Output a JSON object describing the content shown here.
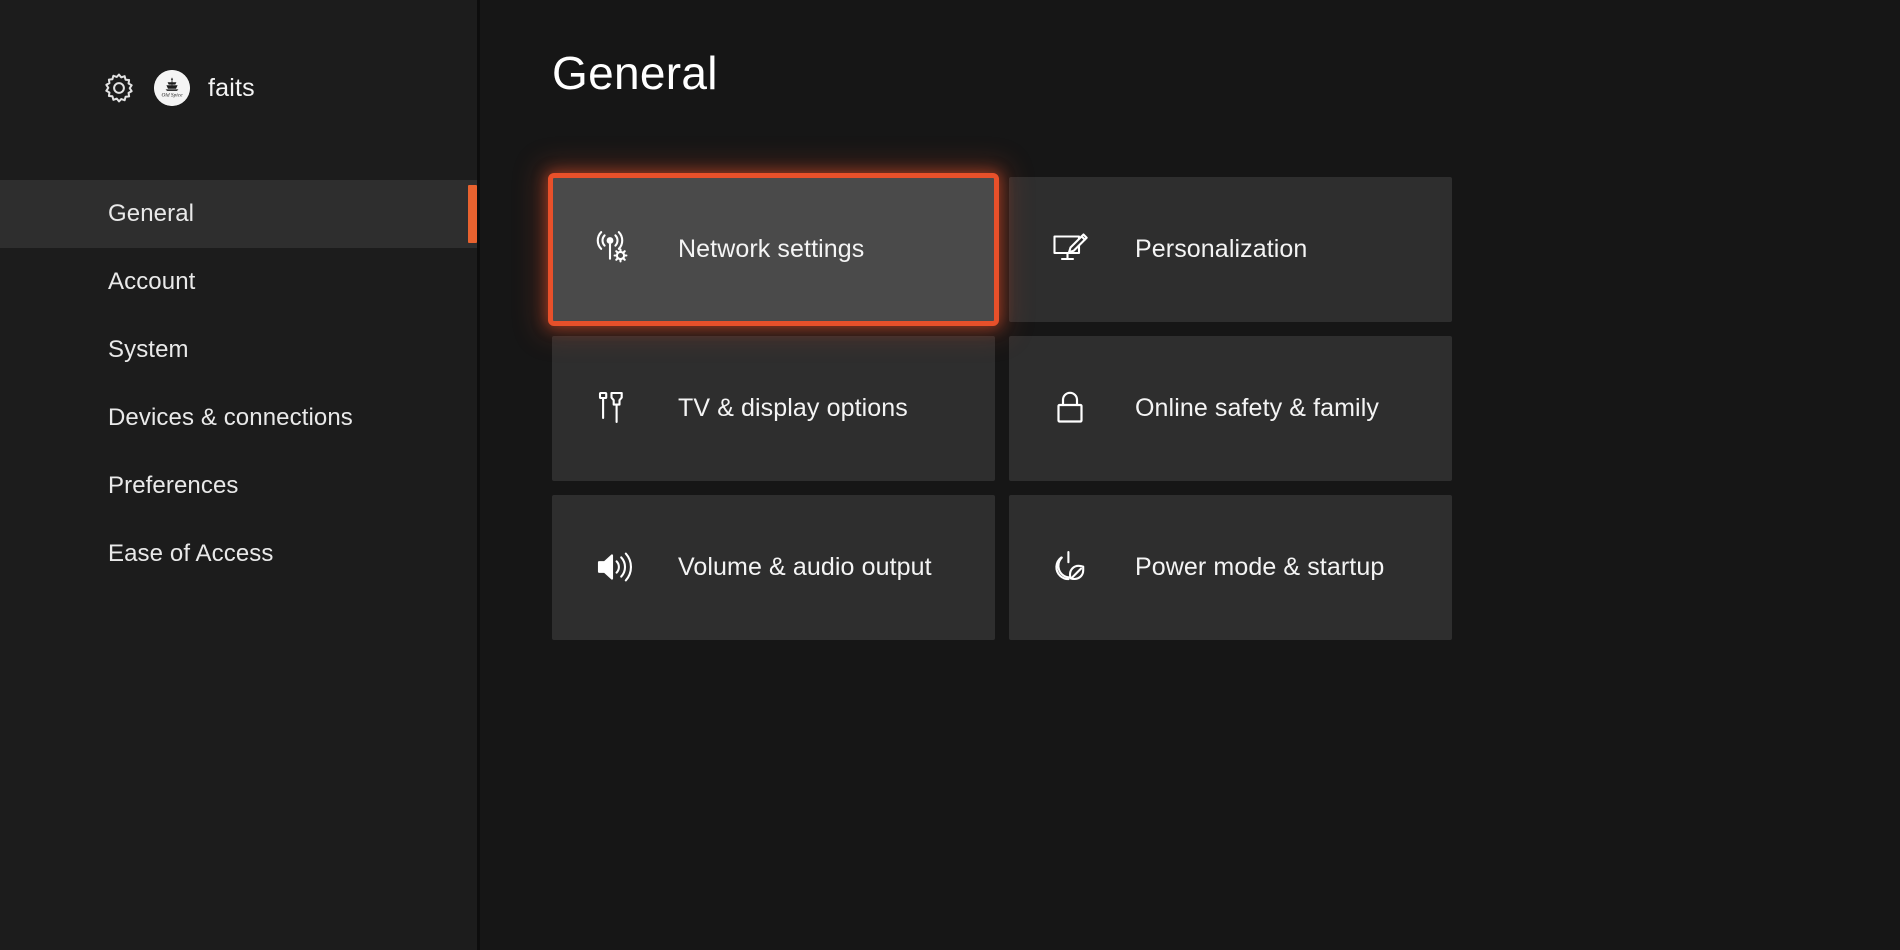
{
  "window": {
    "background_color": "#161616",
    "accent_color": "#e8502a"
  },
  "sidebar": {
    "background_color": "#1c1c1c",
    "profile": {
      "gear_icon": "gear-icon",
      "avatar_icon": "old-spice-avatar",
      "avatar_label": "Old Spice",
      "username": "faits"
    },
    "selected_index": 0,
    "indicator_color": "#e8622f",
    "items": [
      {
        "label": "General",
        "selected": true
      },
      {
        "label": "Account",
        "selected": false
      },
      {
        "label": "System",
        "selected": false
      },
      {
        "label": "Devices & connections",
        "selected": false
      },
      {
        "label": "Preferences",
        "selected": false
      },
      {
        "label": "Ease of Access",
        "selected": false
      }
    ]
  },
  "main": {
    "title": "General",
    "tiles": [
      {
        "label": "Network settings",
        "icon": "network-broadcast-gear-icon",
        "focused": true
      },
      {
        "label": "Personalization",
        "icon": "monitor-paintbrush-icon",
        "focused": false
      },
      {
        "label": "TV & display options",
        "icon": "hdmi-cable-icon",
        "focused": false
      },
      {
        "label": "Online safety & family",
        "icon": "padlock-icon",
        "focused": false
      },
      {
        "label": "Volume & audio output",
        "icon": "speaker-waves-icon",
        "focused": false
      },
      {
        "label": "Power mode & startup",
        "icon": "power-leaf-icon",
        "focused": false
      }
    ]
  }
}
